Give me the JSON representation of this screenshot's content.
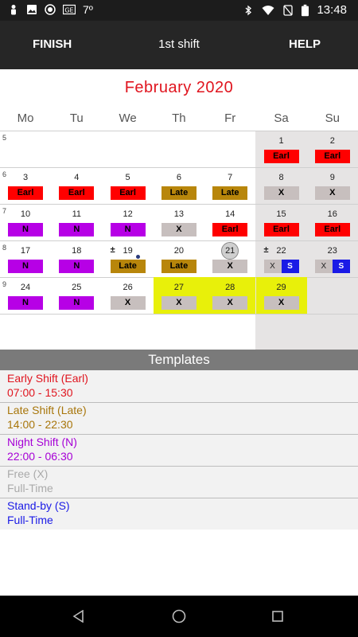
{
  "status_bar": {
    "left_icons": [
      "person-icon",
      "image-icon",
      "camera-icon",
      "ge-icon"
    ],
    "temperature": "7º",
    "right_icons": [
      "bluetooth-icon",
      "wifi-icon",
      "no-sim-icon",
      "battery-icon"
    ],
    "time": "13:48"
  },
  "appbar": {
    "finish": "FINISH",
    "title": "1st shift",
    "help": "HELP"
  },
  "month_title": "February  2020",
  "weekdays": [
    "Mo",
    "Tu",
    "We",
    "Th",
    "Fr",
    "Sa",
    "Su"
  ],
  "week_numbers": [
    "5",
    "6",
    "7",
    "8",
    "9"
  ],
  "colors": {
    "early_bg": "#ff0000",
    "early_text": "#000000",
    "late_bg": "#b8860b",
    "late_text": "#000000",
    "night_bg": "#b700e6",
    "night_text": "#000000",
    "free_bg": "#c7bfbe",
    "free_text": "#000000",
    "standby_bg": "#1a1ae6",
    "standby_text": "#ffffff",
    "highlight": "#e8f00a",
    "accent_red": "#e0141e"
  },
  "weeks": [
    {
      "days": [
        {
          "day": "",
          "shift": ""
        },
        {
          "day": "",
          "shift": ""
        },
        {
          "day": "",
          "shift": ""
        },
        {
          "day": "",
          "shift": ""
        },
        {
          "day": "",
          "shift": ""
        },
        {
          "day": "1",
          "shift": "Earl",
          "type": "early"
        },
        {
          "day": "2",
          "shift": "Earl",
          "type": "early"
        }
      ]
    },
    {
      "days": [
        {
          "day": "3",
          "shift": "Earl",
          "type": "early"
        },
        {
          "day": "4",
          "shift": "Earl",
          "type": "early"
        },
        {
          "day": "5",
          "shift": "Earl",
          "type": "early"
        },
        {
          "day": "6",
          "shift": "Late",
          "type": "late"
        },
        {
          "day": "7",
          "shift": "Late",
          "type": "late"
        },
        {
          "day": "8",
          "shift": "X",
          "type": "free"
        },
        {
          "day": "9",
          "shift": "X",
          "type": "free"
        }
      ]
    },
    {
      "days": [
        {
          "day": "10",
          "shift": "N",
          "type": "night"
        },
        {
          "day": "11",
          "shift": "N",
          "type": "night"
        },
        {
          "day": "12",
          "shift": "N",
          "type": "night"
        },
        {
          "day": "13",
          "shift": "X",
          "type": "free"
        },
        {
          "day": "14",
          "shift": "Earl",
          "type": "early"
        },
        {
          "day": "15",
          "shift": "Earl",
          "type": "early"
        },
        {
          "day": "16",
          "shift": "Earl",
          "type": "early"
        }
      ]
    },
    {
      "days": [
        {
          "day": "17",
          "shift": "N",
          "type": "night"
        },
        {
          "day": "18",
          "shift": "N",
          "type": "night"
        },
        {
          "day": "19",
          "shift": "Late",
          "type": "late",
          "marker": "±",
          "dot": true
        },
        {
          "day": "20",
          "shift": "Late",
          "type": "late"
        },
        {
          "day": "21",
          "shift": "X",
          "type": "free",
          "today": true
        },
        {
          "day": "22",
          "shift": "X",
          "shift2": "S",
          "type": "split",
          "marker": "±"
        },
        {
          "day": "23",
          "shift": "X",
          "shift2": "S",
          "type": "split"
        }
      ]
    },
    {
      "days": [
        {
          "day": "24",
          "shift": "N",
          "type": "night"
        },
        {
          "day": "25",
          "shift": "N",
          "type": "night"
        },
        {
          "day": "26",
          "shift": "X",
          "type": "free"
        },
        {
          "day": "27",
          "shift": "X",
          "type": "free",
          "highlight": true
        },
        {
          "day": "28",
          "shift": "X",
          "type": "free",
          "highlight": true
        },
        {
          "day": "29",
          "shift": "X",
          "type": "free",
          "highlight": true
        },
        {
          "day": "",
          "shift": ""
        }
      ]
    }
  ],
  "templates": {
    "title": "Templates",
    "items": [
      {
        "name": "Early Shift (Earl)",
        "time": "07:00 - 15:30",
        "color": "#e0141e"
      },
      {
        "name": "Late Shift (Late)",
        "time": "14:00 - 22:30",
        "color": "#a8760b"
      },
      {
        "name": "Night Shift (N)",
        "time": "22:00 - 06:30",
        "color": "#a600d6"
      },
      {
        "name": "Free (X)",
        "time": "Full-Time",
        "color": "#aaaaaa"
      },
      {
        "name": "Stand-by (S)",
        "time": "Full-Time",
        "color": "#1a1ae6"
      }
    ]
  }
}
